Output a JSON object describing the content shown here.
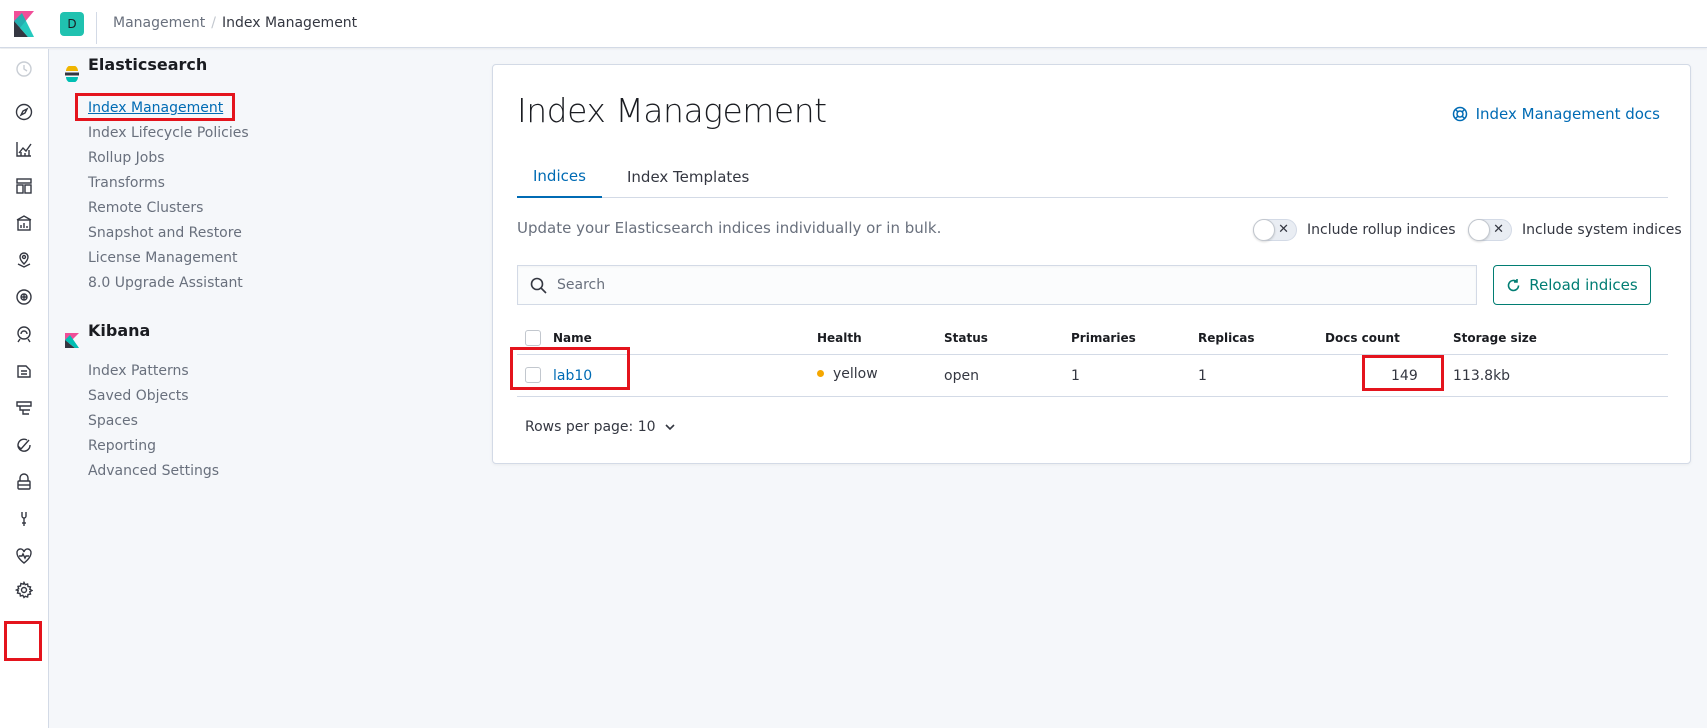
{
  "header": {
    "space_initial": "D",
    "breadcrumbs": [
      "Management",
      "Index Management"
    ]
  },
  "sidemenu": {
    "sections": [
      {
        "title": "Elasticsearch",
        "items": [
          "Index Management",
          "Index Lifecycle Policies",
          "Rollup Jobs",
          "Transforms",
          "Remote Clusters",
          "Snapshot and Restore",
          "License Management",
          "8.0 Upgrade Assistant"
        ]
      },
      {
        "title": "Kibana",
        "items": [
          "Index Patterns",
          "Saved Objects",
          "Spaces",
          "Reporting",
          "Advanced Settings"
        ]
      }
    ]
  },
  "main": {
    "title": "Index Management",
    "docs_link": "Index Management docs",
    "tabs": [
      "Indices",
      "Index Templates"
    ],
    "description": "Update your Elasticsearch indices individually or in bulk.",
    "toggles": [
      "Include rollup indices",
      "Include system indices"
    ],
    "search_placeholder": "Search",
    "reload_button": "Reload indices",
    "table": {
      "columns": [
        "Name",
        "Health",
        "Status",
        "Primaries",
        "Replicas",
        "Docs count",
        "Storage size"
      ],
      "rows": [
        {
          "name": "lab10",
          "health": "yellow",
          "status": "open",
          "primaries": "1",
          "replicas": "1",
          "docs_count": "149",
          "storage_size": "113.8kb"
        }
      ]
    },
    "pager": "Rows per page: 10"
  },
  "colors": {
    "link": "#006bb4",
    "accent": "#017d73",
    "health_yellow": "#f5a700",
    "highlight": "#e4141d",
    "space_avatar": "#20c2b0"
  }
}
